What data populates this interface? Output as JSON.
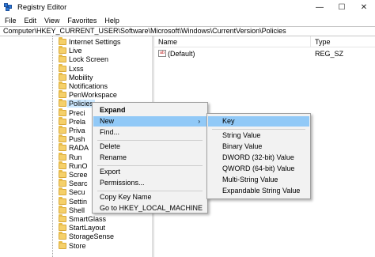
{
  "window": {
    "title": "Registry Editor",
    "minimize": "—",
    "maximize": "☐",
    "close": "✕"
  },
  "menu": [
    "File",
    "Edit",
    "View",
    "Favorites",
    "Help"
  ],
  "address": "Computer\\HKEY_CURRENT_USER\\Software\\Microsoft\\Windows\\CurrentVersion\\Policies",
  "tree": [
    {
      "label": "Internet Settings"
    },
    {
      "label": "Live"
    },
    {
      "label": "Lock Screen"
    },
    {
      "label": "Lxss"
    },
    {
      "label": "Mobility"
    },
    {
      "label": "Notifications"
    },
    {
      "label": "PenWorkspace"
    },
    {
      "label": "Policies",
      "selected": true
    },
    {
      "label": "Preci"
    },
    {
      "label": "Prela"
    },
    {
      "label": "Priva"
    },
    {
      "label": "Push"
    },
    {
      "label": "RADA"
    },
    {
      "label": "Run"
    },
    {
      "label": "RunO"
    },
    {
      "label": "Scree"
    },
    {
      "label": "Searc"
    },
    {
      "label": "Secu"
    },
    {
      "label": "Settin"
    },
    {
      "label": "Shell"
    },
    {
      "label": "SmartGlass"
    },
    {
      "label": "StartLayout"
    },
    {
      "label": "StorageSense"
    },
    {
      "label": "Store"
    }
  ],
  "values": {
    "headers": {
      "name": "Name",
      "type": "Type"
    },
    "rows": [
      {
        "icon": "ab",
        "name": "(Default)",
        "type": "REG_SZ"
      }
    ]
  },
  "context_menu": {
    "items": [
      {
        "label": "Expand",
        "bold": true
      },
      {
        "label": "New",
        "arrow": "›",
        "highlighted": true
      },
      {
        "label": "Find..."
      },
      {
        "label": "Delete"
      },
      {
        "label": "Rename"
      },
      {
        "label": "Export"
      },
      {
        "label": "Permissions..."
      },
      {
        "label": "Copy Key Name"
      },
      {
        "label": "Go to HKEY_LOCAL_MACHINE"
      }
    ]
  },
  "submenu": {
    "items": [
      {
        "label": "Key",
        "highlighted": true
      },
      {
        "label": "String Value"
      },
      {
        "label": "Binary Value"
      },
      {
        "label": "DWORD (32-bit) Value"
      },
      {
        "label": "QWORD (64-bit) Value"
      },
      {
        "label": "Multi-String Value"
      },
      {
        "label": "Expandable String Value"
      }
    ]
  },
  "colors": {
    "highlight": "#91c9f7",
    "selection": "#cce8ff",
    "folder": "#f5d06a"
  }
}
